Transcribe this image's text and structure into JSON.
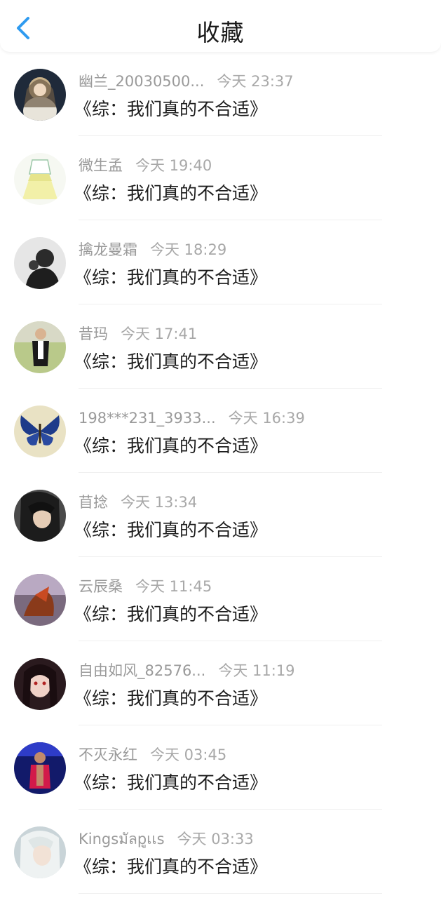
{
  "header": {
    "title": "收藏",
    "back_icon": "chevron-left-icon",
    "accent": "#2f9bf0"
  },
  "items": [
    {
      "name": "幽兰_20030500...",
      "time": "今天 23:37",
      "title": "《综：我们真的不合适》",
      "avatar": "avatar-icon"
    },
    {
      "name": "微生孟",
      "time": "今天 19:40",
      "title": "《综：我们真的不合适》",
      "avatar": "avatar-icon"
    },
    {
      "name": "擒龙曼霜",
      "time": "今天 18:29",
      "title": "《综：我们真的不合适》",
      "avatar": "avatar-icon"
    },
    {
      "name": "昔玛",
      "time": "今天 17:41",
      "title": "《综：我们真的不合适》",
      "avatar": "avatar-icon"
    },
    {
      "name": "198***231_3933...",
      "time": "今天 16:39",
      "title": "《综：我们真的不合适》",
      "avatar": "avatar-icon"
    },
    {
      "name": "苜捻",
      "time": "今天 13:34",
      "title": "《综：我们真的不合适》",
      "avatar": "avatar-icon"
    },
    {
      "name": "云辰桑",
      "time": "今天 11:45",
      "title": "《综：我们真的不合适》",
      "avatar": "avatar-icon"
    },
    {
      "name": "自由如风_82576...",
      "time": "今天 11:19",
      "title": "《综：我们真的不合适》",
      "avatar": "avatar-icon"
    },
    {
      "name": "不灭永红",
      "time": "今天 03:45",
      "title": "《综：我们真的不合适》",
      "avatar": "avatar-icon"
    },
    {
      "name": "Kingsมัลpูเเs",
      "time": "今天 03:33",
      "title": "《综：我们真的不合适》",
      "avatar": "avatar-icon"
    }
  ]
}
